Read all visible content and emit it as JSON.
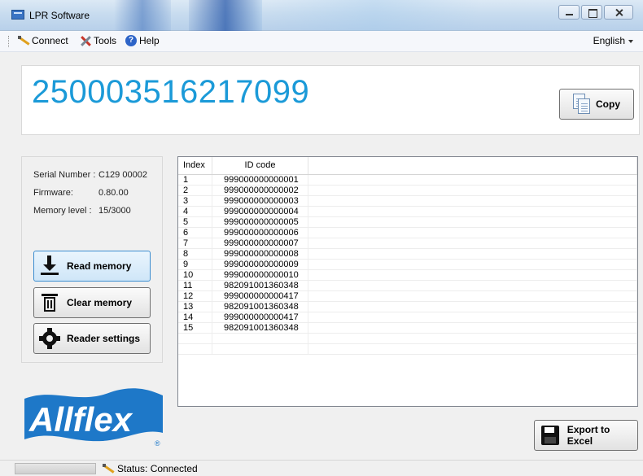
{
  "window": {
    "title": "LPR Software",
    "controls": {
      "minimize": "minimize",
      "maximize": "maximize",
      "close": "close"
    }
  },
  "menu": {
    "connect": "Connect",
    "tools": "Tools",
    "help": "Help",
    "language": "English"
  },
  "current_id": {
    "value": "250003516217099",
    "copy_label": "Copy",
    "color": "#1b9ad8"
  },
  "device_info": {
    "serial_label": "Serial Number :",
    "serial_value": "C129 00002",
    "firmware_label": "Firmware:",
    "firmware_value": "0.80.00",
    "memory_label": "Memory level :",
    "memory_value": "15/3000"
  },
  "actions": {
    "read_memory": "Read memory",
    "clear_memory": "Clear memory",
    "reader_settings": "Reader settings",
    "export_to_excel": "Export to Excel"
  },
  "logo": {
    "text": "Allflex",
    "color": "#1e78c8",
    "registered": "®"
  },
  "table": {
    "columns": [
      "Index",
      "ID code"
    ],
    "rows": [
      [
        "1",
        "999000000000001"
      ],
      [
        "2",
        "999000000000002"
      ],
      [
        "3",
        "999000000000003"
      ],
      [
        "4",
        "999000000000004"
      ],
      [
        "5",
        "999000000000005"
      ],
      [
        "6",
        "999000000000006"
      ],
      [
        "7",
        "999000000000007"
      ],
      [
        "8",
        "999000000000008"
      ],
      [
        "9",
        "999000000000009"
      ],
      [
        "10",
        "999000000000010"
      ],
      [
        "11",
        "982091001360348"
      ],
      [
        "12",
        "999000000000417"
      ],
      [
        "13",
        "982091001360348"
      ],
      [
        "14",
        "999000000000417"
      ],
      [
        "15",
        "982091001360348"
      ]
    ]
  },
  "status": {
    "text": "Status: Connected"
  }
}
